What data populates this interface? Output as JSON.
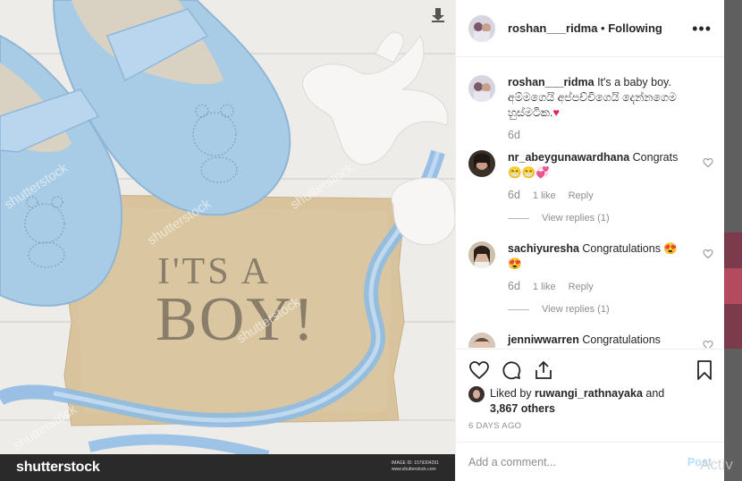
{
  "photo": {
    "headline_line1": "I'TS A",
    "headline_line2": "BOY!",
    "watermark": "shutterstock",
    "brand": "shutterstock",
    "image_id_label": "IMAGE ID: 1579304291",
    "image_site": "www.shutterstock.com"
  },
  "post": {
    "author": "roshan___ridma",
    "separator": " • ",
    "follow_status": "Following",
    "more_label": "•••",
    "caption_text": "It's a baby boy. අම්මගෙයි අප්පච්චිගෙයි දෙන්නගෙම හුස්මටික.",
    "caption_emoji": "♥",
    "caption_time": "6d"
  },
  "comments": [
    {
      "user": "nr_abeygunawardhana",
      "text": "Congrats",
      "emoji": "😁😁💞",
      "time": "6d",
      "likes": "1 like",
      "reply_label": "Reply",
      "view_replies": "View replies (1)"
    },
    {
      "user": "sachiyuresha",
      "text": "Congratulations 😍",
      "emoji": "😍",
      "time": "6d",
      "likes": "1 like",
      "reply_label": "Reply",
      "view_replies": "View replies (1)"
    },
    {
      "user": "jenniwwarren",
      "text": "Congratulations"
    }
  ],
  "likes": {
    "prefix": "Liked by ",
    "first_user": "ruwangi_rathnayaka",
    "joiner": " and",
    "others": "3,867 others"
  },
  "date": "6 DAYS AGO",
  "add_comment": {
    "placeholder": "Add a comment...",
    "post_label": "Post"
  },
  "overlay": {
    "activate_text": "Activ"
  },
  "colors": {
    "shoe_blue": "#a9cce6",
    "card_tan": "#d9c49b",
    "headline": "#8a7d6a",
    "heart_red": "#e0245e"
  }
}
